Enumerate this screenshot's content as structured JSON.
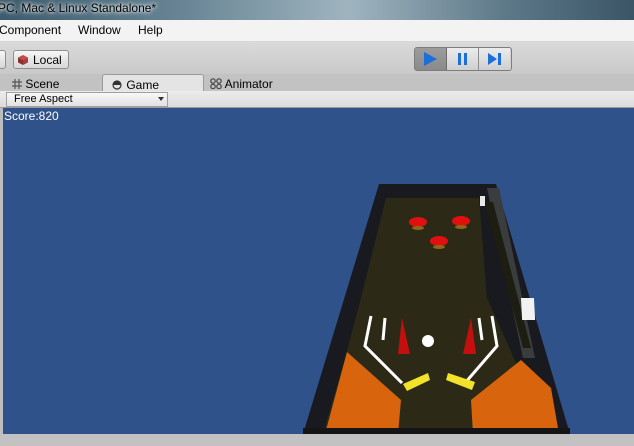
{
  "window": {
    "title": "PC, Mac & Linux Standalone*"
  },
  "menu": {
    "items": [
      "Component",
      "Window",
      "Help"
    ]
  },
  "toolbar": {
    "local_label": "Local",
    "play_icon": "play-icon",
    "pause_icon": "pause-icon",
    "step_icon": "step-icon",
    "play_active": true
  },
  "tabs": [
    {
      "label": "Scene",
      "icon": "scene-icon",
      "active": false
    },
    {
      "label": "Game",
      "icon": "game-icon",
      "active": true
    },
    {
      "label": "Animator",
      "icon": "animator-icon",
      "active": false
    }
  ],
  "game": {
    "aspect": "Free Aspect",
    "score_text": "Score:820"
  },
  "colors": {
    "viewport_bg": "#30528a",
    "board_frame": "#181a1f",
    "playfield": "#2c2a16",
    "bumper": "#e01010",
    "flipper": "#f2e22a",
    "rail": "#ffffff",
    "orange_slope": "#d8640e",
    "play_button_blue": "#1a6fd8"
  }
}
